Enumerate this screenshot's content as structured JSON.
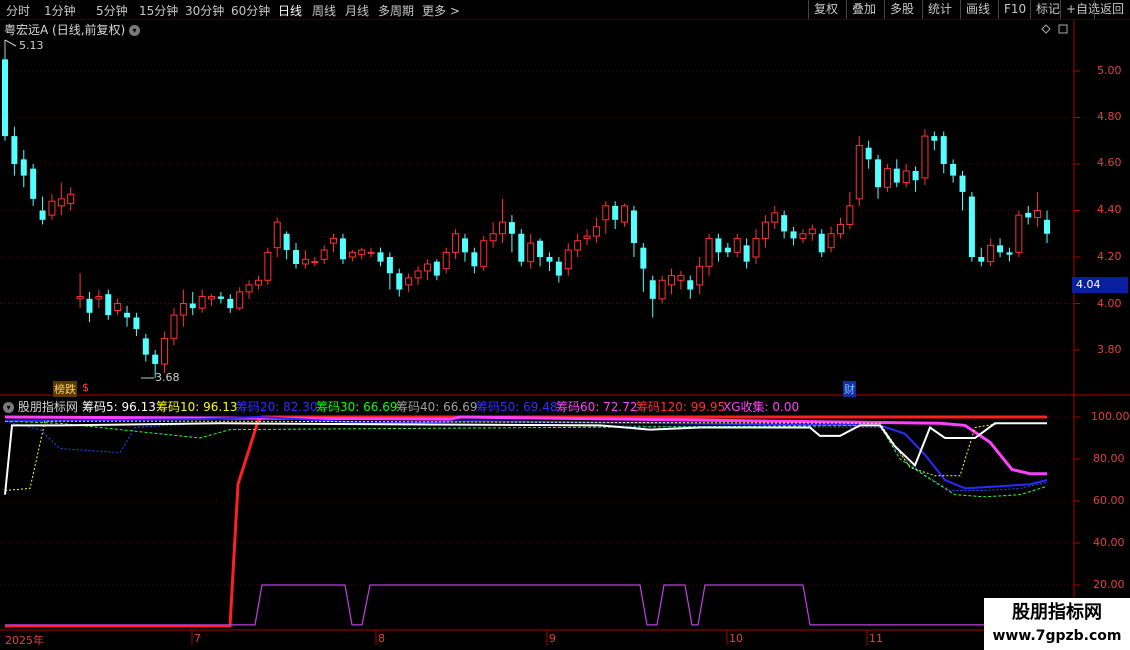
{
  "toolbar": {
    "timeframes": [
      "分时",
      "1分钟",
      "5分钟",
      "15分钟",
      "30分钟",
      "60分钟",
      "日线",
      "周线",
      "月线",
      "多周期",
      "更多 >"
    ],
    "active_timeframe": "日线",
    "right_buttons": [
      "复权",
      "叠加",
      "多股",
      "统计",
      "画线",
      "F10",
      "标记",
      "+自选",
      "返回"
    ]
  },
  "stock": {
    "title": "粤宏远A (日线,前复权)",
    "high_label": "5.13",
    "low_label": "3.68",
    "current_price": "4.04"
  },
  "price_axis": [
    "5.00",
    "4.80",
    "4.60",
    "4.40",
    "4.20",
    "4.00",
    "3.80"
  ],
  "indicator": {
    "name": "股朋指标网",
    "values": [
      {
        "text": "筹码5: 96.13",
        "color": "#ffffff"
      },
      {
        "text": "筹码10: 96.13",
        "color": "#ffff00"
      },
      {
        "text": "筹码20: 82.30",
        "color": "#3030ff"
      },
      {
        "text": "筹码30: 66.69",
        "color": "#00ff00"
      },
      {
        "text": "筹码40: 66.69",
        "color": "#a0a0a0"
      },
      {
        "text": "筹码50: 69.48",
        "color": "#3030ff"
      },
      {
        "text": "筹码60: 72.72",
        "color": "#ff40ff"
      },
      {
        "text": "筹码120: 99.95",
        "color": "#ff3030"
      },
      {
        "text": "XG收集: 0.00",
        "color": "#ff40ff"
      }
    ],
    "axis": [
      "100.00",
      "80.00",
      "60.00",
      "40.00",
      "20.00"
    ]
  },
  "dates": [
    "2025年",
    "7",
    "8",
    "9",
    "10",
    "11"
  ],
  "badges": {
    "lbl1": "榜跌",
    "lbl2": "$",
    "lbl3": "财"
  },
  "watermark": {
    "line1": "股朋指标网",
    "line2": "www.7gpzb.com"
  },
  "chart_data": {
    "type": "candlestick",
    "title": "粤宏远A (日线,前复权)",
    "ylim": [
      3.6,
      5.2
    ],
    "x_labels": [
      "2025年",
      "7",
      "8",
      "9",
      "10",
      "11"
    ],
    "candles": [
      [
        5.05,
        4.72,
        5.13,
        4.7
      ],
      [
        4.72,
        4.6,
        4.76,
        4.55
      ],
      [
        4.62,
        4.55,
        4.66,
        4.5
      ],
      [
        4.58,
        4.45,
        4.6,
        4.42
      ],
      [
        4.4,
        4.36,
        4.46,
        4.34
      ],
      [
        4.38,
        4.44,
        4.47,
        4.36
      ],
      [
        4.42,
        4.45,
        4.52,
        4.38
      ],
      [
        4.43,
        4.47,
        4.5,
        4.4
      ],
      [
        4.02,
        4.03,
        4.13,
        3.98
      ],
      [
        4.02,
        3.96,
        4.05,
        3.92
      ],
      [
        4.02,
        4.03,
        4.06,
        3.98
      ],
      [
        4.04,
        3.95,
        4.06,
        3.93
      ],
      [
        3.97,
        4.0,
        4.02,
        3.95
      ],
      [
        3.96,
        3.94,
        3.99,
        3.9
      ],
      [
        3.94,
        3.89,
        3.96,
        3.86
      ],
      [
        3.85,
        3.78,
        3.87,
        3.75
      ],
      [
        3.78,
        3.74,
        3.8,
        3.68
      ],
      [
        3.74,
        3.85,
        3.88,
        3.7
      ],
      [
        3.85,
        3.95,
        3.98,
        3.82
      ],
      [
        3.95,
        4.0,
        4.06,
        3.9
      ],
      [
        4.0,
        3.98,
        4.05,
        3.95
      ],
      [
        3.98,
        4.03,
        4.06,
        3.96
      ],
      [
        4.02,
        4.03,
        4.04,
        3.99
      ],
      [
        4.03,
        4.02,
        4.05,
        4.0
      ],
      [
        4.02,
        3.98,
        4.04,
        3.96
      ],
      [
        3.98,
        4.05,
        4.07,
        3.97
      ],
      [
        4.05,
        4.08,
        4.1,
        4.02
      ],
      [
        4.08,
        4.1,
        4.12,
        4.06
      ],
      [
        4.1,
        4.22,
        4.24,
        4.08
      ],
      [
        4.24,
        4.35,
        4.37,
        4.2
      ],
      [
        4.3,
        4.23,
        4.31,
        4.19
      ],
      [
        4.23,
        4.17,
        4.26,
        4.15
      ],
      [
        4.17,
        4.19,
        4.23,
        4.15
      ],
      [
        4.18,
        4.18,
        4.2,
        4.16
      ],
      [
        4.19,
        4.23,
        4.25,
        4.17
      ],
      [
        4.26,
        4.28,
        4.3,
        4.22
      ],
      [
        4.28,
        4.19,
        4.3,
        4.17
      ],
      [
        4.2,
        4.22,
        4.23,
        4.18
      ],
      [
        4.21,
        4.23,
        4.24,
        4.19
      ],
      [
        4.22,
        4.22,
        4.24,
        4.2
      ],
      [
        4.22,
        4.18,
        4.24,
        4.16
      ],
      [
        4.2,
        4.13,
        4.22,
        4.06
      ],
      [
        4.13,
        4.06,
        4.15,
        4.03
      ],
      [
        4.08,
        4.11,
        4.13,
        4.05
      ],
      [
        4.11,
        4.14,
        4.16,
        4.08
      ],
      [
        4.14,
        4.17,
        4.19,
        4.1
      ],
      [
        4.18,
        4.12,
        4.19,
        4.1
      ],
      [
        4.15,
        4.22,
        4.24,
        4.13
      ],
      [
        4.22,
        4.3,
        4.32,
        4.19
      ],
      [
        4.28,
        4.22,
        4.3,
        4.18
      ],
      [
        4.22,
        4.16,
        4.24,
        4.13
      ],
      [
        4.16,
        4.27,
        4.29,
        4.14
      ],
      [
        4.27,
        4.3,
        4.35,
        4.24
      ],
      [
        4.3,
        4.35,
        4.45,
        4.26
      ],
      [
        4.35,
        4.3,
        4.38,
        4.22
      ],
      [
        4.3,
        4.18,
        4.32,
        4.16
      ],
      [
        4.18,
        4.26,
        4.3,
        4.15
      ],
      [
        4.27,
        4.2,
        4.28,
        4.16
      ],
      [
        4.2,
        4.18,
        4.22,
        4.14
      ],
      [
        4.18,
        4.12,
        4.2,
        4.09
      ],
      [
        4.15,
        4.23,
        4.26,
        4.12
      ],
      [
        4.23,
        4.27,
        4.3,
        4.2
      ],
      [
        4.28,
        4.29,
        4.32,
        4.25
      ],
      [
        4.29,
        4.33,
        4.37,
        4.26
      ],
      [
        4.36,
        4.42,
        4.44,
        4.3
      ],
      [
        4.42,
        4.36,
        4.44,
        4.32
      ],
      [
        4.35,
        4.42,
        4.43,
        4.33
      ],
      [
        4.4,
        4.26,
        4.42,
        4.2
      ],
      [
        4.24,
        4.15,
        4.26,
        4.05
      ],
      [
        4.1,
        4.02,
        4.12,
        3.94
      ],
      [
        4.02,
        4.1,
        4.12,
        4.0
      ],
      [
        4.08,
        4.12,
        4.15,
        4.04
      ],
      [
        4.1,
        4.12,
        4.14,
        4.06
      ],
      [
        4.1,
        4.06,
        4.12,
        4.02
      ],
      [
        4.08,
        4.16,
        4.2,
        4.04
      ],
      [
        4.16,
        4.28,
        4.3,
        4.12
      ],
      [
        4.28,
        4.22,
        4.3,
        4.18
      ],
      [
        4.24,
        4.22,
        4.26,
        4.2
      ],
      [
        4.22,
        4.28,
        4.3,
        4.2
      ],
      [
        4.25,
        4.18,
        4.28,
        4.15
      ],
      [
        4.2,
        4.28,
        4.32,
        4.17
      ],
      [
        4.28,
        4.35,
        4.38,
        4.24
      ],
      [
        4.35,
        4.39,
        4.42,
        4.32
      ],
      [
        4.38,
        4.31,
        4.4,
        4.28
      ],
      [
        4.31,
        4.28,
        4.33,
        4.25
      ],
      [
        4.28,
        4.3,
        4.32,
        4.26
      ],
      [
        4.3,
        4.32,
        4.34,
        4.27
      ],
      [
        4.3,
        4.22,
        4.32,
        4.2
      ],
      [
        4.24,
        4.3,
        4.33,
        4.22
      ],
      [
        4.3,
        4.34,
        4.37,
        4.28
      ],
      [
        4.34,
        4.42,
        4.48,
        4.32
      ],
      [
        4.45,
        4.68,
        4.72,
        4.42
      ],
      [
        4.67,
        4.62,
        4.7,
        4.58
      ],
      [
        4.62,
        4.5,
        4.64,
        4.45
      ],
      [
        4.5,
        4.58,
        4.6,
        4.48
      ],
      [
        4.58,
        4.52,
        4.62,
        4.5
      ],
      [
        4.52,
        4.57,
        4.6,
        4.5
      ],
      [
        4.57,
        4.53,
        4.59,
        4.48
      ],
      [
        4.54,
        4.72,
        4.75,
        4.51
      ],
      [
        4.72,
        4.7,
        4.74,
        4.66
      ],
      [
        4.72,
        4.6,
        4.74,
        4.56
      ],
      [
        4.6,
        4.55,
        4.62,
        4.52
      ],
      [
        4.55,
        4.48,
        4.57,
        4.4
      ],
      [
        4.46,
        4.2,
        4.48,
        4.18
      ],
      [
        4.2,
        4.18,
        4.24,
        4.16
      ],
      [
        4.18,
        4.25,
        4.28,
        4.16
      ],
      [
        4.25,
        4.22,
        4.28,
        4.2
      ],
      [
        4.22,
        4.21,
        4.24,
        4.18
      ],
      [
        4.22,
        4.38,
        4.4,
        4.2
      ],
      [
        4.39,
        4.37,
        4.42,
        4.34
      ],
      [
        4.37,
        4.4,
        4.48,
        4.33
      ],
      [
        4.36,
        4.3,
        4.4,
        4.26
      ]
    ],
    "indicator_series": {
      "ylim": [
        0,
        100
      ],
      "筹码5": 96.13,
      "筹码10": 96.13,
      "筹码20": 82.3,
      "筹码30": 66.69,
      "筹码40": 66.69,
      "筹码50": 69.48,
      "筹码60": 72.72,
      "筹码120": 99.95,
      "XG收集": 0.0
    }
  }
}
